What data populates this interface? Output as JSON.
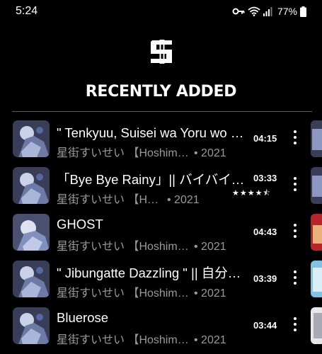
{
  "status_bar": {
    "time": "5:24",
    "battery": "77%",
    "icons": [
      "key-icon",
      "wifi-icon",
      "signal-icon",
      "battery-icon"
    ]
  },
  "header": {
    "logo_icon": "app-logo-s-icon",
    "title": "RECENTLY ADDED"
  },
  "tracks": [
    {
      "title": "\" Tenkyuu, Suisei wa Yoru wo Daite \" || 天球、彗星は夜を抱く",
      "artist": "星街すいせい 【Hoshimachi Suisei】",
      "year": "• 2021",
      "duration": "04:15"
    },
    {
      "title": "「Bye Bye Rainy」|| バイバイレイニー",
      "artist": "星街すいせい 【Hoshimachi Suisei】",
      "year": "• 2021",
      "duration": "03:33",
      "rating": 4.5
    },
    {
      "title": "GHOST",
      "artist": "星街すいせい 【Hoshimachi Suisei】",
      "year": "• 2021",
      "duration": "04:43"
    },
    {
      "title": "\" Jibungatte Dazzling \" || 自分勝手Dazzling",
      "artist": "星街すいせい 【Hoshimachi Suisei】",
      "year": "• 2021",
      "duration": "03:39"
    },
    {
      "title": "Bluerose",
      "artist": "星街すいせい 【Hoshimachi Suisei】",
      "year": "• 2021",
      "duration": "03:44"
    }
  ],
  "colors": {
    "background": "#000000",
    "text": "#ffffff",
    "secondary_text": "#9a9a9a",
    "divider": "#5a5a5a"
  }
}
